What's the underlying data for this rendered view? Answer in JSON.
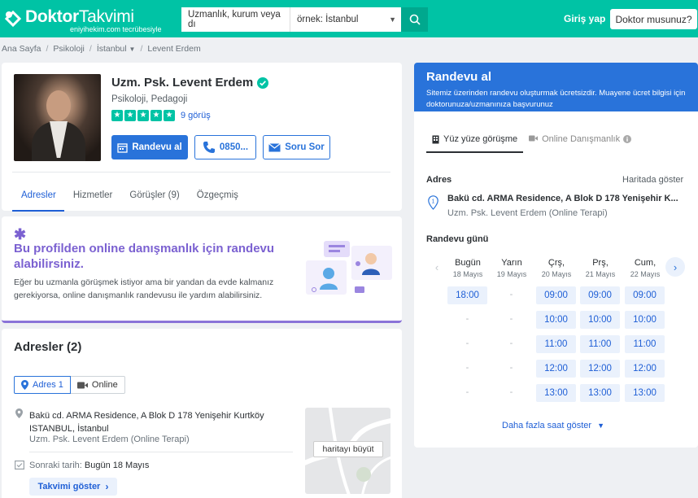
{
  "header": {
    "logo_bold": "Doktor",
    "logo_light": "Takvimi",
    "logo_sub": "eniyihekim.com tecrübesiyle",
    "search_placeholder": "Uzmanlık, kurum veya dı",
    "location_placeholder": "örnek: İstanbul",
    "login": "Giriş yap",
    "doctor_button": "Doktor musunuz?",
    "brand_color": "#00c3a5",
    "icons": [
      "logo-icon",
      "chevron-down-icon",
      "search-icon"
    ]
  },
  "breadcrumb": [
    "Ana Sayfa",
    "Psikoloji",
    "İstanbul",
    "Levent Erdem"
  ],
  "profile": {
    "name": "Uzm. Psk. Levent Erdem",
    "specialty": "Psikoloji, Pedagoji",
    "rating": 5,
    "reviews": "9 görüş",
    "book_label": "Randevu al",
    "phone_label": "0850...",
    "ask_label": "Soru Sor",
    "tabs": [
      "Adresler",
      "Hizmetler",
      "Görüşler (9)",
      "Özgeçmiş"
    ],
    "active_tab": "Adresler"
  },
  "online": {
    "title": "Bu profilden online danışmanlık için randevu alabilirsiniz.",
    "description": "Eğer bu uzmanla görüşmek istiyor ama bir yandan da evde kalmanız gerekiyorsa, online danışmanlık randevusu ile yardım alabilirsiniz.",
    "accent": "#7b61d1"
  },
  "addresses": {
    "title": "Adresler (2)",
    "tabs": [
      "Adres 1",
      "Online"
    ],
    "line1": "Bakü cd. ARMA Residence, A Blok D 178 Yenişehir Kurtköy",
    "line2": "ISTANBUL, İstanbul",
    "sub": "Uzm. Psk. Levent Erdem (Online Terapi)",
    "next_label": "Sonraki tarih:",
    "next_value": "Bugün 18 Mayıs",
    "show_calendar": "Takvimi göster",
    "map_button": "haritayı büyüt"
  },
  "booking": {
    "title": "Randevu al",
    "subtitle": "Sitemiz üzerinden randevu oluşturmak ücretsizdir. Muayene ücret bilgisi için doktorunuza/uzmanınıza başvurunuz",
    "tabs": [
      "Yüz yüze görüşme",
      "Online Danışmanlık"
    ],
    "address_label": "Adres",
    "map_link": "Haritada göster",
    "address": "Bakü cd. ARMA Residence, A Blok D 178 Yenişehir K...",
    "address_sub": "Uzm. Psk. Levent Erdem (Online Terapi)",
    "day_label": "Randevu günü",
    "days": [
      {
        "name": "Bugün",
        "date": "18 Mayıs",
        "slots": [
          "18:00",
          "-",
          "-",
          "-",
          "-"
        ]
      },
      {
        "name": "Yarın",
        "date": "19 Mayıs",
        "slots": [
          "-",
          "-",
          "-",
          "-",
          "-"
        ]
      },
      {
        "name": "Çrş,",
        "date": "20 Mayıs",
        "slots": [
          "09:00",
          "10:00",
          "11:00",
          "12:00",
          "13:00"
        ]
      },
      {
        "name": "Prş,",
        "date": "21 Mayıs",
        "slots": [
          "09:00",
          "10:00",
          "11:00",
          "12:00",
          "13:00"
        ]
      },
      {
        "name": "Cum,",
        "date": "22 Mayıs",
        "slots": [
          "09:00",
          "10:00",
          "11:00",
          "12:00",
          "13:00"
        ]
      }
    ],
    "more_hours": "Daha fazla saat göster",
    "accent": "#2973da"
  }
}
